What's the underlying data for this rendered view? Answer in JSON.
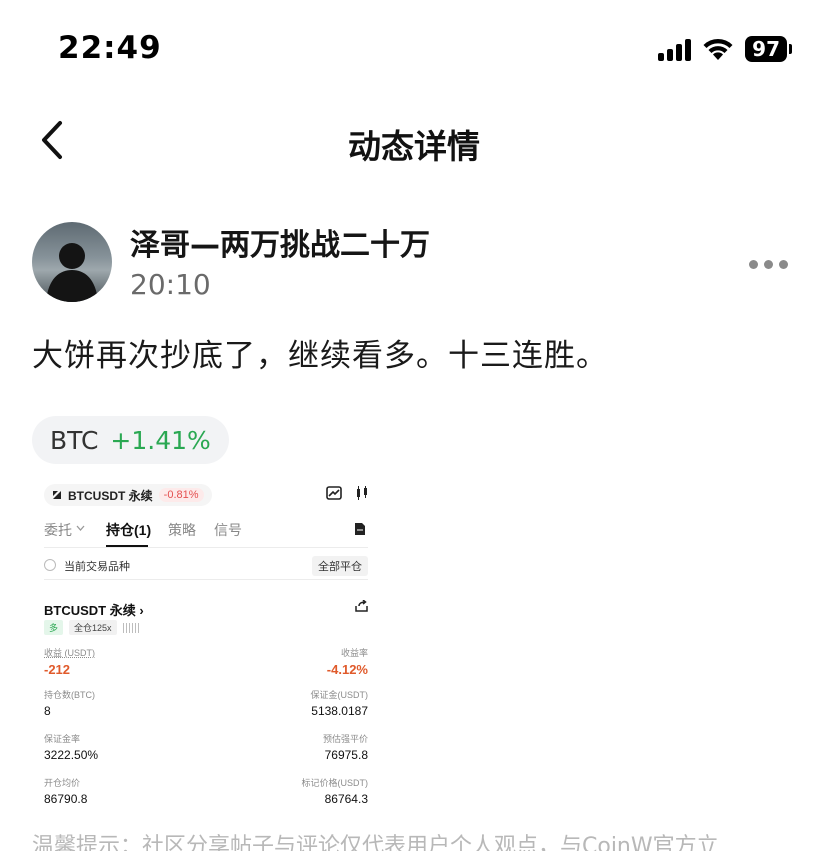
{
  "status_bar": {
    "time": "22:49",
    "battery": "97",
    "icons": [
      "cellular-signal-icon",
      "wifi-icon",
      "battery-icon"
    ]
  },
  "nav": {
    "back_icon": "chevron-left-icon",
    "title": "动态详情"
  },
  "post": {
    "author_name": "泽哥—两万挑战二十万",
    "time": "20:10",
    "more_icon": "more-dots-icon",
    "body": "大饼再次抄底了，继续看多。十三连胜。"
  },
  "coin_tag": {
    "symbol": "BTC",
    "change": "+1.41%",
    "change_color": "#2aa852"
  },
  "screenshot": {
    "pair_label": "BTCUSDT 永续",
    "pair_change": "-0.81%",
    "tabs": [
      {
        "label": "委托",
        "active": false
      },
      {
        "label": "持仓(1)",
        "active": true
      },
      {
        "label": "策略",
        "active": false
      },
      {
        "label": "信号",
        "active": false
      }
    ],
    "filter_label": "当前交易品种",
    "close_all_label": "全部平仓",
    "position": {
      "title": "BTCUSDT 永续",
      "tag_side": "多",
      "tag_margin": "全仓125x"
    },
    "fields": [
      {
        "label": "收益 (USDT)",
        "value": "-212"
      },
      {
        "label": "收益率",
        "value": "-4.12%"
      },
      {
        "label": "持仓数(BTC)",
        "value": "8"
      },
      {
        "label": "保证金(USDT)",
        "value": "5138.0187"
      },
      {
        "label": "保证金率",
        "value": "3222.50%"
      },
      {
        "label": "预估强平价",
        "value": "76975.8"
      },
      {
        "label": "开仓均价",
        "value": "86790.8"
      },
      {
        "label": "标记价格(USDT)",
        "value": "86764.3"
      }
    ]
  },
  "disclaimer": "温馨提示：社区分享帖子与评论仅代表用户个人观点，与CoinW官方立"
}
